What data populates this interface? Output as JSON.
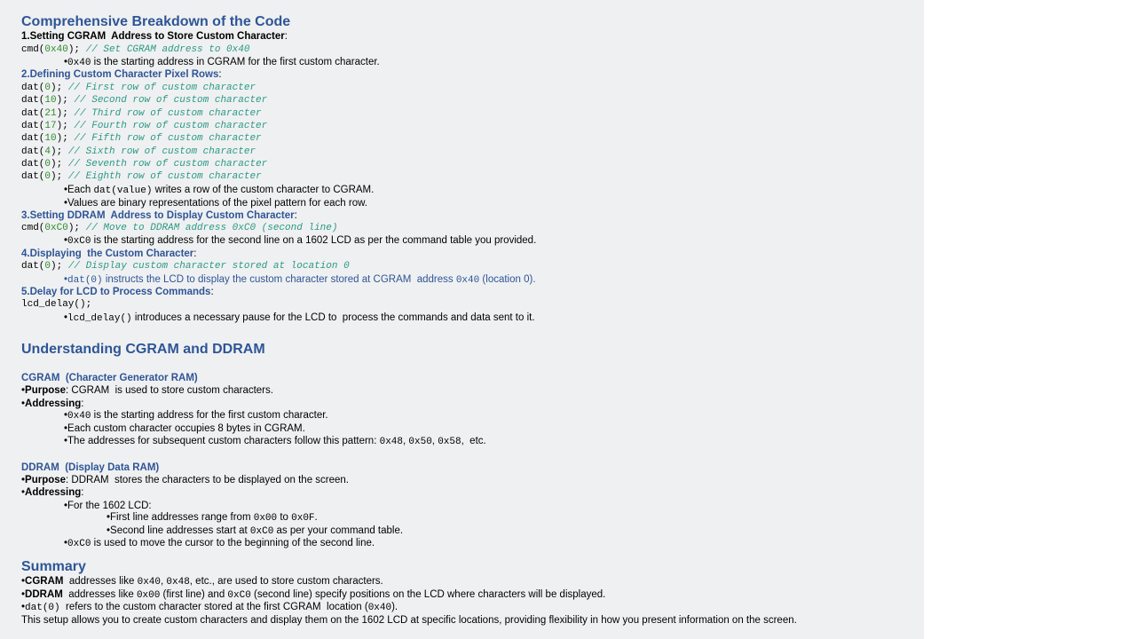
{
  "title1": "Comprehensive Breakdown of the Code",
  "s1": {
    "heading": "1.Setting CGRAM  Address to Store Custom Character",
    "colon": ":",
    "code_fn": "cmd(",
    "code_num": "0x40",
    "code_end": ");",
    "code_comment": "// Set CGRAM address to 0x40",
    "bullet": "•",
    "b1_code": "0x40",
    "b1_text": " is the starting address in CGRAM for the first custom character."
  },
  "s2": {
    "heading": "2.Defining Custom Character Pixel Rows",
    "colon": ":",
    "rows": [
      {
        "fn": "dat(",
        "num": "0",
        "end": ");",
        "comment": "// First row of custom character"
      },
      {
        "fn": "dat(",
        "num": "10",
        "end": ");",
        "comment": "// Second row of custom character"
      },
      {
        "fn": "dat(",
        "num": "21",
        "end": ");",
        "comment": "// Third row of custom character"
      },
      {
        "fn": "dat(",
        "num": "17",
        "end": ");",
        "comment": "// Fourth row of custom character"
      },
      {
        "fn": "dat(",
        "num": "10",
        "end": ");",
        "comment": "// Fifth row of custom character"
      },
      {
        "fn": "dat(",
        "num": "4",
        "end": ");",
        "comment": "// Sixth row of custom character"
      },
      {
        "fn": "dat(",
        "num": "0",
        "end": ");",
        "comment": "// Seventh row of custom character"
      },
      {
        "fn": "dat(",
        "num": "0",
        "end": ");",
        "comment": "// Eighth row of custom character"
      }
    ],
    "b1_pre": "•Each ",
    "b1_code": "dat(value)",
    "b1_text": " writes a row of the custom character to CGRAM.",
    "b2": "•Values are binary representations of the pixel pattern for each row."
  },
  "s3": {
    "heading": "3.Setting DDRAM  Address to Display Custom Character",
    "colon": ":",
    "code_fn": "cmd(",
    "code_num": "0xC0",
    "code_end": ");",
    "code_comment": "// Move to DDRAM address 0xC0 (second line)",
    "bullet": "•",
    "b1_code": "0xC0",
    "b1_text": " is the starting address for the second line on a 1602 LCD as per the command table you provided."
  },
  "s4": {
    "heading": "4.Displaying  the Custom Character",
    "colon": ":",
    "code_fn": "dat(",
    "code_num": "0",
    "code_end": ");",
    "code_comment": "// Display custom character stored at location 0",
    "bullet": "•",
    "b1_code": "dat(0)",
    "b1_text": " instructs the LCD to display the custom character stored at CGRAM  address ",
    "b1_code2": "0x40",
    "b1_tail": " (location 0)."
  },
  "s5": {
    "heading": "5.Delay for LCD to Process Commands",
    "colon": ":",
    "code": "lcd_delay();",
    "bullet": "•",
    "b1_code": "lcd_delay()",
    "b1_text": " introduces a necessary pause for the LCD to  process the commands and data sent to it."
  },
  "title2": "Understanding CGRAM and DDRAM",
  "cgram": {
    "heading": "CGRAM  (Character Generator RAM)",
    "purpose_label": "Purpose",
    "purpose_text": ": CGRAM  is used to store custom characters.",
    "addr_label": "Addressing",
    "addr_colon": ":",
    "bullet": "•",
    "b1_code": "0x40",
    "b1_text": " is the starting address for the first custom character.",
    "b2": "•Each custom character occupies 8 bytes in CGRAM.",
    "b3_pre": "•The addresses for subsequent custom characters follow this pattern: ",
    "b3_c1": "0x48",
    "b3_sep1": ", ",
    "b3_c2": "0x50",
    "b3_sep2": ", ",
    "b3_c3": "0x58",
    "b3_tail": ",  etc."
  },
  "ddram": {
    "heading": "DDRAM  (Display Data RAM)",
    "purpose_label": "Purpose",
    "purpose_text": ": DDRAM  stores the characters to be displayed on the screen.",
    "addr_label": "Addressing",
    "addr_colon": ":",
    "b1": "•For the 1602 LCD:",
    "s1_pre": "•First line addresses range from ",
    "s1_c1": "0x00",
    "s1_mid": " to ",
    "s1_c2": "0x0F",
    "s1_tail": ".",
    "s2_pre": "•Second line addresses start at ",
    "s2_c": "0xC0",
    "s2_tail": " as per your command table.",
    "bullet": "•",
    "b2_code": "0xC0",
    "b2_text": " is used to move the cursor to the beginning of the second line."
  },
  "title3": "Summary",
  "summary": {
    "bullet": "•",
    "l1_label": "CGRAM",
    "l1_pre": "  addresses like ",
    "l1_c1": "0x40",
    "l1_sep": ", ",
    "l1_c2": "0x48",
    "l1_tail": ", etc., are used to store custom characters.",
    "l2_label": "DDRAM",
    "l2_pre": "  addresses like ",
    "l2_c1": "0x00",
    "l2_mid": " (first line) and ",
    "l2_c2": "0xC0",
    "l2_tail": " (second line) specify positions on the LCD where characters will be displayed.",
    "l3_code": "dat(0)",
    "l3_text": "  refers to the custom character stored at the first CGRAM  location (",
    "l3_c": "0x40",
    "l3_tail": ").",
    "l4": "This setup allows you to create custom characters and display them on the 1602 LCD at specific locations, providing flexibility in how you present information on the screen."
  }
}
